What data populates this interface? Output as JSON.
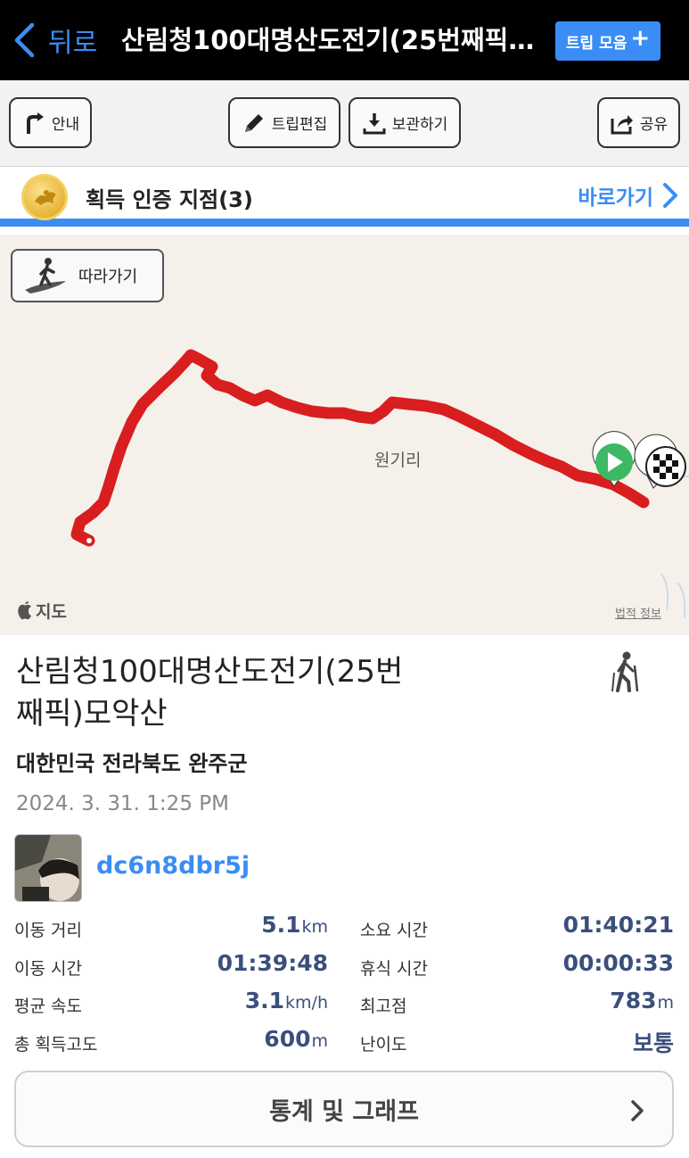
{
  "nav": {
    "back_label": "뒤로",
    "title": "산림청100대명산도전기(25번째픽)모악산",
    "trip_collection_label": "트립 모음",
    "trip_collection_plus": "+",
    "accent": "#3a8df5"
  },
  "toolbar": {
    "guide_label": "안내",
    "edit_label": "트립편집",
    "save_label": "보관하기",
    "share_label": "공유"
  },
  "cert": {
    "title": "획득 인증 지점(3)",
    "go_label": "바로가기"
  },
  "map": {
    "follow_label": "따라가기",
    "place_label": "원기리",
    "brand_label": "지도",
    "legal_label": "법적 정보",
    "route_color": "#d81e1e"
  },
  "trip": {
    "title": "산림청100대명산도전기(25번째픽)모악산",
    "region": "대한민국 전라북도 완주군",
    "datetime": "2024. 3. 31. 1:25 PM",
    "username": "dc6n8dbr5j",
    "activity_icon": "hiker-icon"
  },
  "stats": {
    "distance": {
      "label": "이동 거리",
      "value": "5.1",
      "unit": "km"
    },
    "total_time": {
      "label": "소요 시간",
      "value": "01:40:21",
      "unit": ""
    },
    "moving_time": {
      "label": "이동 시간",
      "value": "01:39:48",
      "unit": ""
    },
    "rest_time": {
      "label": "휴식 시간",
      "value": "00:00:33",
      "unit": ""
    },
    "avg_speed": {
      "label": "평균 속도",
      "value": "3.1",
      "unit": "km/h"
    },
    "max_elevation": {
      "label": "최고점",
      "value": "783",
      "unit": "m"
    },
    "total_ascent": {
      "label": "총 획득고도",
      "value": "600",
      "unit": "m"
    },
    "difficulty": {
      "label": "난이도",
      "value": "보통",
      "unit": ""
    }
  },
  "graph_button": {
    "label": "통계 및 그래프"
  }
}
